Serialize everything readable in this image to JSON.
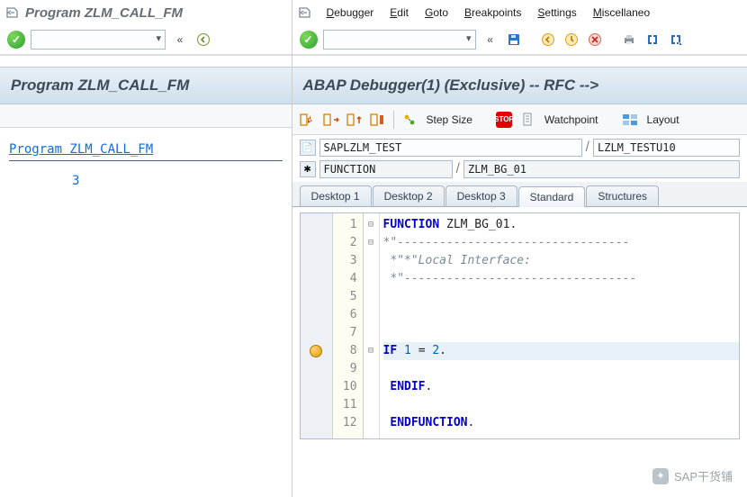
{
  "left": {
    "title": "Program ZLM_CALL_FM",
    "header": "Program ZLM_CALL_FM",
    "body_link": "Program ZLM_CALL_FM",
    "body_value": "3"
  },
  "right": {
    "menus": [
      "Debugger",
      "Edit",
      "Goto",
      "Breakpoints",
      "Settings",
      "Miscellaneo"
    ],
    "header": "ABAP Debugger(1)  (Exclusive) -- RFC --> ",
    "toolbar": {
      "stepsize": "Step Size",
      "watchpoint": "Watchpoint",
      "layout": "Layout"
    },
    "fields": {
      "program": "SAPLZLM_TEST",
      "include": "LZLM_TESTU10",
      "event_type": "FUNCTION",
      "event_name": "ZLM_BG_01"
    },
    "tabs": [
      "Desktop 1",
      "Desktop 2",
      "Desktop 3",
      "Standard",
      "Structures"
    ],
    "active_tab": 3,
    "code": {
      "lines": [
        {
          "n": 1,
          "fold": "⊟",
          "html": "<span class='kw'>FUNCTION</span> <span class='plain'>ZLM_BG_01</span><span class='plain'>.</span>"
        },
        {
          "n": 2,
          "fold": "⊟",
          "html": "<span class='cmt'>*\"---------------------------------</span>"
        },
        {
          "n": 3,
          "fold": "",
          "html": "<span class='cmt'> *\"*\"Local Interface:</span>"
        },
        {
          "n": 4,
          "fold": "",
          "html": "<span class='cmt'> *\"---------------------------------</span>"
        },
        {
          "n": 5,
          "fold": "",
          "html": ""
        },
        {
          "n": 6,
          "fold": "",
          "html": ""
        },
        {
          "n": 7,
          "fold": "",
          "html": ""
        },
        {
          "n": 8,
          "fold": "⊟",
          "html": "<span class='kw'>IF</span> <span class='num'>1</span> <span class='plain'>=</span> <span class='num'>2</span><span class='plain'>.</span>",
          "hl": true,
          "bp": true
        },
        {
          "n": 9,
          "fold": "",
          "html": ""
        },
        {
          "n": 10,
          "fold": "",
          "html": " <span class='kw'>ENDIF</span><span class='plain'>.</span>"
        },
        {
          "n": 11,
          "fold": "",
          "html": ""
        },
        {
          "n": 12,
          "fold": "",
          "html": " <span class='kw'>ENDFUNCTION</span><span class='plain'>.</span>"
        }
      ]
    }
  },
  "watermark": "SAP干货铺"
}
